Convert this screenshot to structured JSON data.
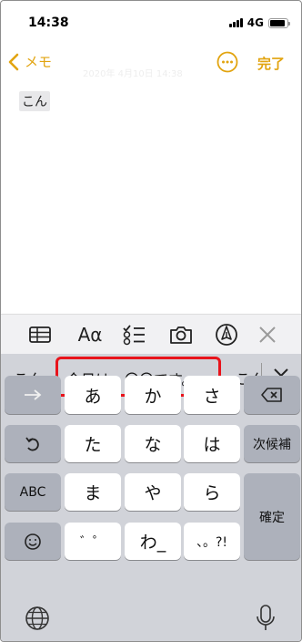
{
  "status_bar": {
    "time": "14:38",
    "network": "4G",
    "battery_level_percent": 90
  },
  "nav": {
    "back_label": "メモ",
    "date_faded": "2020年 4月10日 14:38",
    "done_label": "完了"
  },
  "note": {
    "text": "こん"
  },
  "toolbar": {
    "icons": [
      "table-icon",
      "text-format-icon",
      "checklist-icon",
      "camera-icon",
      "markup-icon",
      "close-icon"
    ],
    "format_label": "Aα"
  },
  "candidates": {
    "first": "こん",
    "highlighted": "今日は、〇〇です。",
    "next": "こん"
  },
  "keys": {
    "a": "あ",
    "ka": "か",
    "sa": "さ",
    "ta": "た",
    "na": "な",
    "ha": "は",
    "ma": "ま",
    "ya": "や",
    "ra": "ら",
    "dakuten": "゛゜",
    "wa": "わ_",
    "punct": "、。?!",
    "space": "次候補",
    "confirm": "確定",
    "abc": "ABC"
  },
  "colors": {
    "accent": "#e2a410",
    "highlight_border": "#e8131b"
  }
}
